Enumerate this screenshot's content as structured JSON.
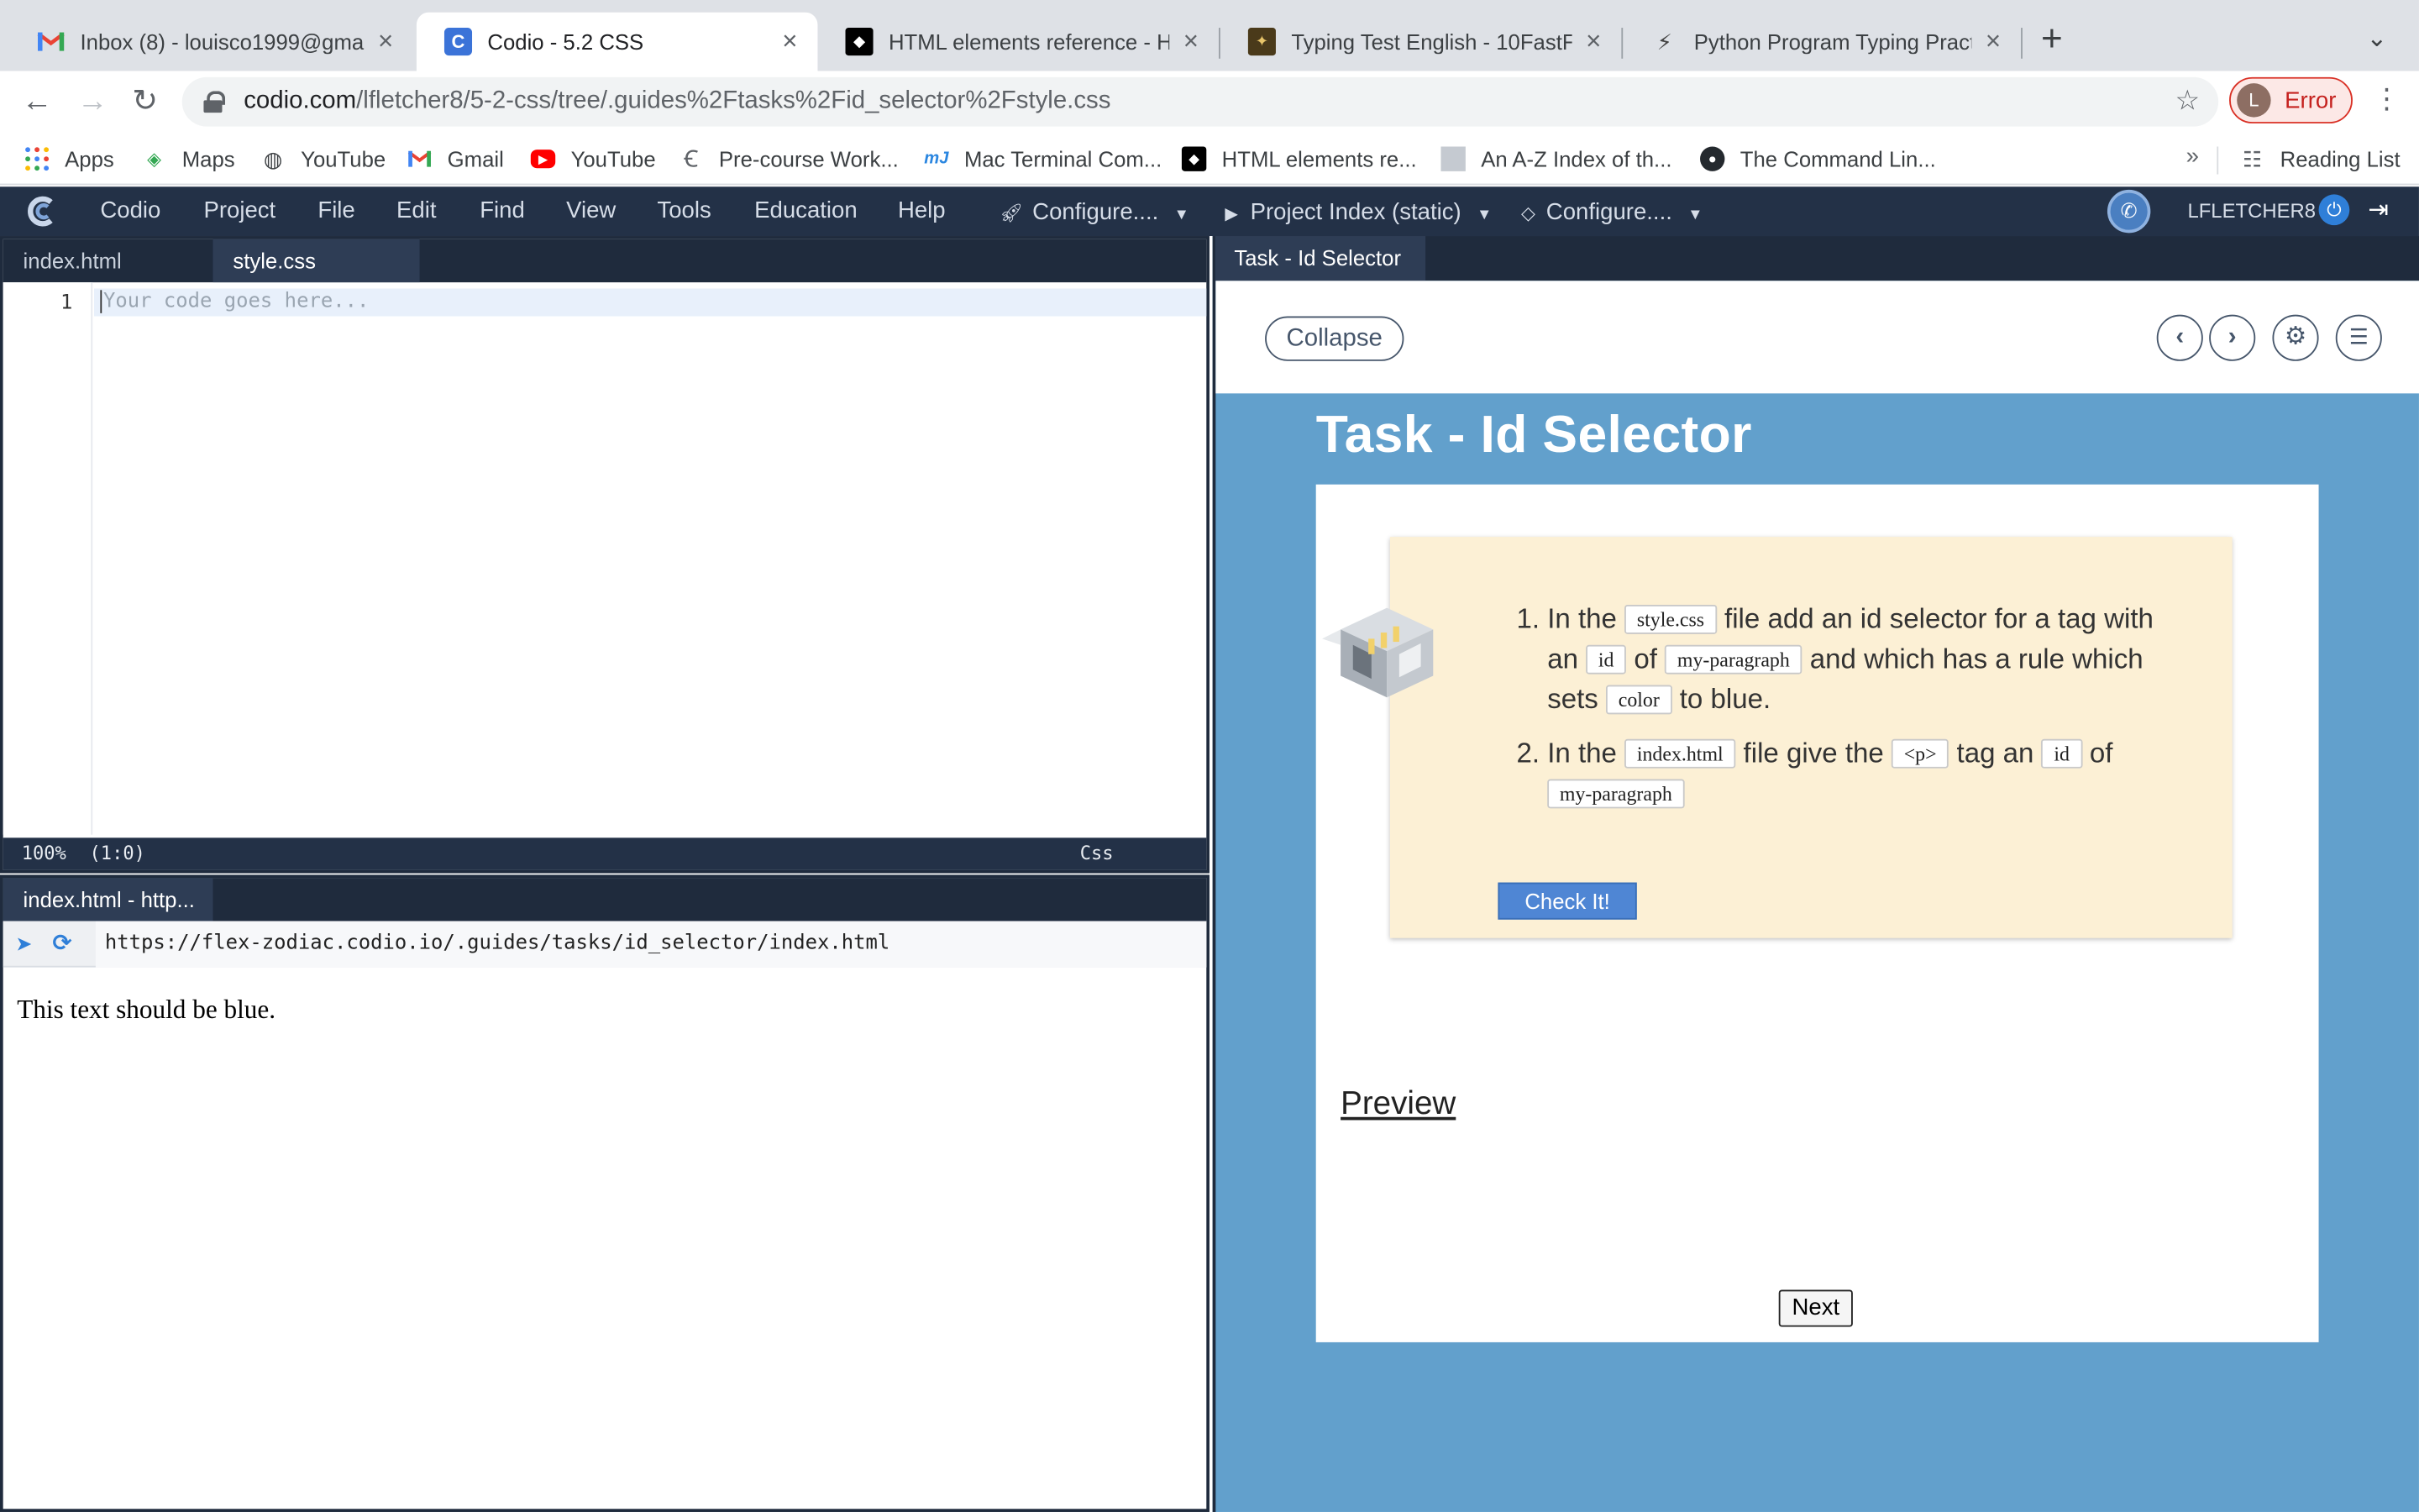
{
  "browser": {
    "tabs": [
      {
        "title": "Inbox (8) - louisco1999@gmail.",
        "icon": "gmail-icon"
      },
      {
        "title": "Codio - 5.2 CSS",
        "icon": "codio-icon",
        "active": true
      },
      {
        "title": "HTML elements reference - HT",
        "icon": "mdn-icon"
      },
      {
        "title": "Typing Test English - 10FastFin",
        "icon": "tenfastfingers-icon"
      },
      {
        "title": "Python Program Typing Practic",
        "icon": "lightning-icon"
      }
    ],
    "url_host": "codio.com",
    "url_path": "/lfletcher8/5-2-css/tree/.guides%2Ftasks%2Fid_selector%2Fstyle.css",
    "profile_initial": "L",
    "profile_status": "Error",
    "bookmarks": [
      {
        "label": "Apps",
        "icon": "apps-grid-icon"
      },
      {
        "label": "Maps",
        "icon": "maps-icon"
      },
      {
        "label": "YouTube",
        "icon": "globe-icon"
      },
      {
        "label": "Gmail",
        "icon": "gmail-icon"
      },
      {
        "label": "YouTube",
        "icon": "youtube-icon"
      },
      {
        "label": "Pre-course Work...",
        "icon": "c-logo-icon"
      },
      {
        "label": "Mac Terminal Com...",
        "icon": "mj-icon"
      },
      {
        "label": "HTML elements re...",
        "icon": "mdn-icon"
      },
      {
        "label": "An A-Z Index of th...",
        "icon": "page-icon"
      },
      {
        "label": "The Command Lin...",
        "icon": "github-icon"
      }
    ],
    "bookmarks_more": "»",
    "reading_list": "Reading List"
  },
  "codio": {
    "menu": [
      "Codio",
      "Project",
      "File",
      "Edit",
      "Find",
      "View",
      "Tools",
      "Education",
      "Help"
    ],
    "configure1": "Configure....",
    "project_index": "Project Index (static)",
    "configure2": "Configure....",
    "username": "LFLETCHER8"
  },
  "editor": {
    "tabs": [
      "index.html",
      "style.css"
    ],
    "active_tab": "style.css",
    "line_number": "1",
    "placeholder": "Your code goes here...",
    "status_zoom": "100%",
    "status_pos": "(1:0)",
    "status_mode": "Css"
  },
  "preview": {
    "tab": "index.html - http...",
    "url": "https://flex-zodiac.codio.io/.guides/tasks/id_selector/index.html",
    "text": "This text should be blue."
  },
  "guide": {
    "tab": "Task - Id Selector",
    "collapse": "Collapse",
    "title": "Task - Id Selector",
    "steps": {
      "s1_a": "In the",
      "s1_code1": "style.css",
      "s1_b": "file add an id selector for a tag with an",
      "s1_code2": "id",
      "s1_c": "of",
      "s1_code3": "my-paragraph",
      "s1_d": "and which has a rule which sets",
      "s1_code4": "color",
      "s1_e": "to blue.",
      "s2_a": "In the",
      "s2_code1": "index.html",
      "s2_b": "file give the",
      "s2_code2": "<p>",
      "s2_c": "tag an",
      "s2_code3": "id",
      "s2_d": "of",
      "s2_code4": "my-paragraph"
    },
    "check_button": "Check It!",
    "preview_link": "Preview",
    "next_button": "Next"
  },
  "colors": {
    "codio_navy": "#233147",
    "guide_blue": "#62a0cc",
    "task_bg": "#fcf0d5",
    "check_button": "#4f86d4",
    "error_red": "#c5221f"
  }
}
